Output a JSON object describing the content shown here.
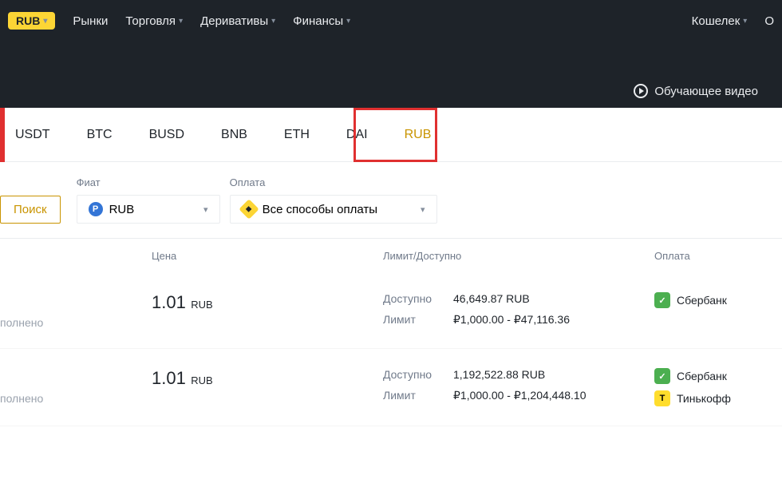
{
  "nav": {
    "badge": "RUB",
    "items": [
      "Рынки",
      "Торговля",
      "Деривативы",
      "Финансы"
    ],
    "wallet": "Кошелек",
    "or": "О",
    "tutorial": "Обучающее видео"
  },
  "asset_tabs": [
    "USDT",
    "BTC",
    "BUSD",
    "BNB",
    "ETH",
    "DAI",
    "RUB"
  ],
  "filters": {
    "search": "Поиск",
    "fiat_label": "Фиат",
    "fiat_value": "RUB",
    "payment_label": "Оплата",
    "payment_value": "Все способы оплаты"
  },
  "table_headers": {
    "price": "Цена",
    "limit": "Лимит/Доступно",
    "payment": "Оплата"
  },
  "labels": {
    "available": "Доступно",
    "limit": "Лимит",
    "completed": "полнено"
  },
  "listings": [
    {
      "price": "1.01",
      "unit": "RUB",
      "available": "46,649.87 RUB",
      "limit": "₽1,000.00 - ₽47,116.36",
      "payments": [
        {
          "name": "Сбербанк",
          "class": "sber",
          "g": "✓"
        }
      ]
    },
    {
      "price": "1.01",
      "unit": "RUB",
      "available": "1,192,522.88 RUB",
      "limit": "₽1,000.00 - ₽1,204,448.10",
      "payments": [
        {
          "name": "Сбербанк",
          "class": "sber",
          "g": "✓"
        },
        {
          "name": "Тинькофф",
          "class": "tink",
          "g": "T"
        }
      ]
    }
  ]
}
